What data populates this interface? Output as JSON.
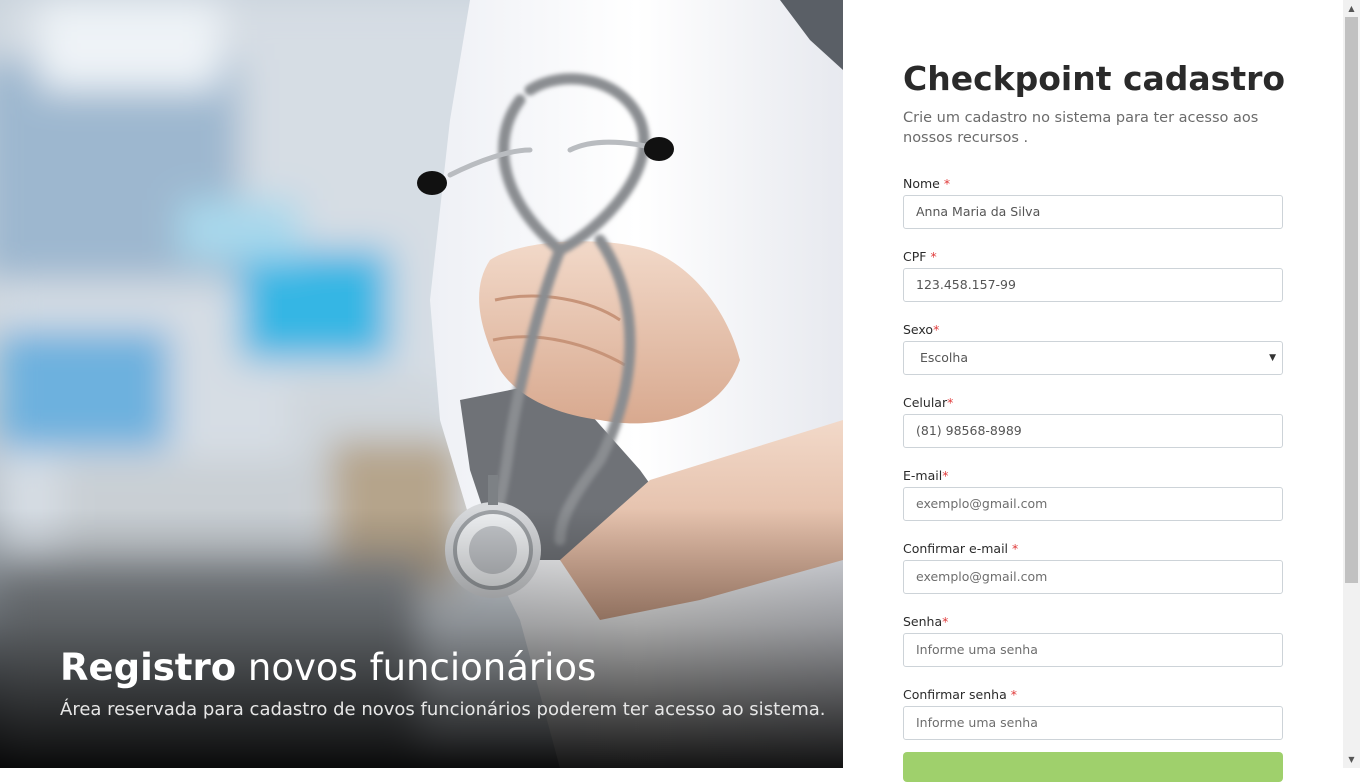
{
  "hero": {
    "title_bold": "Registro",
    "title_rest": "novos funcionários",
    "subtitle": "Área reservada para cadastro de novos funcionários poderem ter acesso ao sistema."
  },
  "form": {
    "title": "Checkpoint cadastro",
    "description": "Crie um cadastro no sistema para ter acesso aos nossos recursos .",
    "required_mark": "*",
    "fields": [
      {
        "label": "Nome ",
        "value": "Anna Maria da Silva"
      },
      {
        "label": "CPF ",
        "value": "123.458.157-99"
      },
      {
        "label": "Sexo",
        "value": "Escolha",
        "arrow": "▼"
      },
      {
        "label": "Celular",
        "value": "(81) 98568-8989"
      },
      {
        "label": "E-mail",
        "value": "exemplo@gmail.com"
      },
      {
        "label": "Confirmar e-mail ",
        "value": "exemplo@gmail.com"
      },
      {
        "label": "Senha",
        "value": "Informe uma senha"
      },
      {
        "label": "Confirmar senha ",
        "value": "Informe uma senha"
      }
    ],
    "submit_color": "#9fd06c"
  },
  "colors": {
    "accent_required": "#e03a3a",
    "title_text": "#2a2a2a"
  },
  "scrollbar": {
    "up": "▲",
    "down": "▼"
  }
}
